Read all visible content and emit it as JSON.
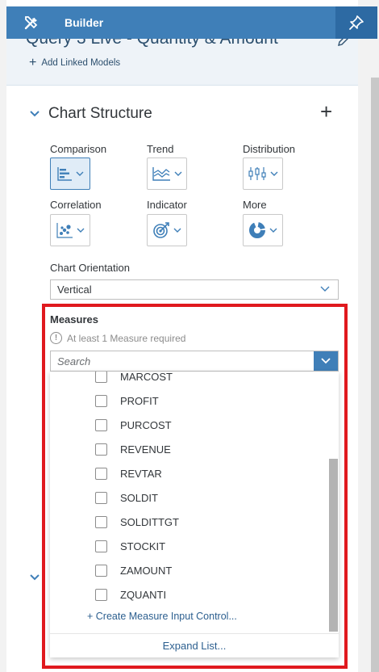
{
  "header": {
    "title": "Builder"
  },
  "model": {
    "title": "Query 3 Live - Quantity & Amount",
    "add_linked_models": "Add Linked Models"
  },
  "chart_structure": {
    "title": "Chart Structure",
    "types": [
      {
        "label": "Comparison",
        "icon": "bar-chart-icon",
        "selected": true
      },
      {
        "label": "Trend",
        "icon": "area-chart-icon",
        "selected": false
      },
      {
        "label": "Distribution",
        "icon": "box-plot-icon",
        "selected": false
      },
      {
        "label": "Correlation",
        "icon": "scatter-chart-icon",
        "selected": false
      },
      {
        "label": "Indicator",
        "icon": "target-icon",
        "selected": false
      },
      {
        "label": "More",
        "icon": "donut-chart-icon",
        "selected": false
      }
    ],
    "orientation_label": "Chart Orientation",
    "orientation_value": "Vertical"
  },
  "measures": {
    "label": "Measures",
    "warning": "At least 1 Measure required",
    "search_placeholder": "Search",
    "items": [
      "MARCOST",
      "PROFIT",
      "PURCOST",
      "REVENUE",
      "REVTAR",
      "SOLDIT",
      "SOLDITTGT",
      "STOCKIT",
      "ZAMOUNT",
      "ZQUANTI"
    ],
    "create_control": "+ Create Measure Input Control...",
    "expand_list": "Expand List..."
  },
  "colors": {
    "header_bg": "#3f7fb8",
    "highlight": "#e0191e",
    "link": "#2c5f8f"
  }
}
